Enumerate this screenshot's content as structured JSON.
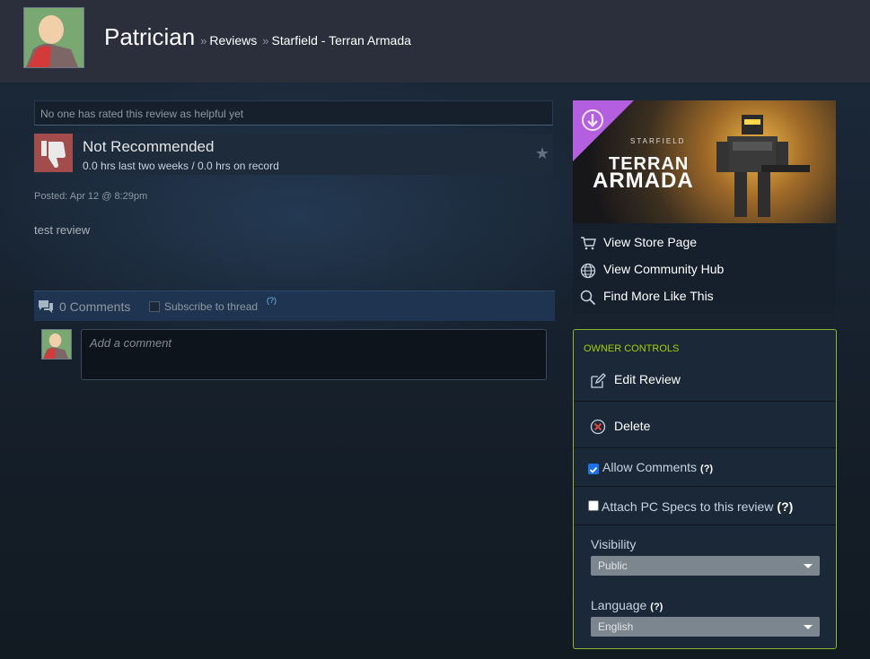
{
  "header": {
    "username": "Patrician",
    "sep1": "»",
    "crumb_reviews": "Reviews",
    "sep2": "»",
    "crumb_app": "Starfield - Terran Armada"
  },
  "review": {
    "helpful_text": "No one has rated this review as helpful yet",
    "recommendation": "Not Recommended",
    "hours": "0.0 hrs last two weeks / 0.0 hrs on record",
    "posted": "Posted: Apr 12 @ 8:29pm",
    "body": "test review"
  },
  "comments": {
    "count_label": "0 Comments",
    "subscribe_label": "Subscribe to thread",
    "subscribe_help": "(?)",
    "subscribed": false,
    "placeholder": "Add a comment"
  },
  "app": {
    "capsule_small": "STARFIELD",
    "capsule_line1": "TERRAN",
    "capsule_line2": "ARMADA",
    "links": [
      {
        "label": "View Store Page",
        "icon": "cart-icon"
      },
      {
        "label": "View Community Hub",
        "icon": "globe-icon"
      },
      {
        "label": "Find More Like This",
        "icon": "magnifier-icon"
      }
    ]
  },
  "owner": {
    "title": "OWNER CONTROLS",
    "edit_label": "Edit Review",
    "delete_label": "Delete",
    "allow_comments_label": "Allow Comments",
    "allow_comments_help": "(?)",
    "allow_comments_checked": true,
    "pc_specs_label": "Attach PC Specs to this review",
    "pc_specs_help": "(?)",
    "pc_specs_checked": false,
    "visibility_label": "Visibility",
    "visibility_value": "Public",
    "language_label": "Language",
    "language_help": "(?)",
    "language_value": "English"
  },
  "colors": {
    "background": "#1b2838",
    "header": "#2a2f3b",
    "accent_link": "#66c0f4",
    "thumb_down": "#a34c4c",
    "owner_border": "#8bb72f",
    "owner_title": "#a4d007",
    "dlc_corner": "#b45ee0"
  }
}
